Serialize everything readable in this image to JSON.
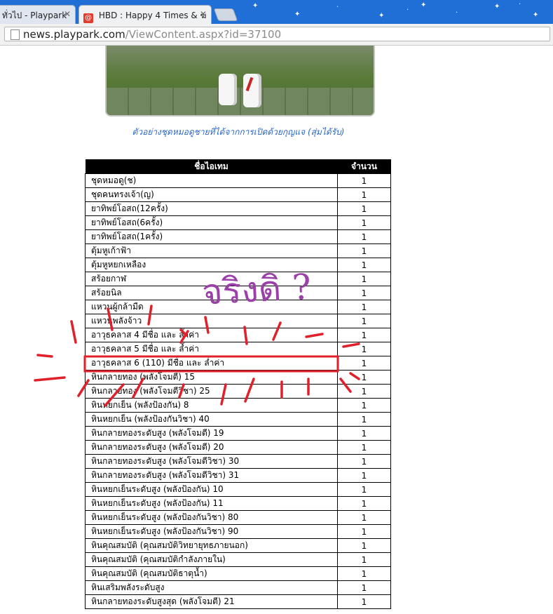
{
  "browser": {
    "tabs": [
      {
        "label": "ทั่วไป - Playpark",
        "active": false
      },
      {
        "label": "HBD : Happy 4 Times & ฆ",
        "active": true
      }
    ],
    "url_host": "news.playpark.com",
    "url_path": "/ViewContent.aspx?id=37100"
  },
  "content": {
    "caption": "ตัวอย่างชุดหมอดูชายที่ได้จากการเปิดด้วยกุญแจ (สุ่มได้รับ)",
    "table": {
      "headers": [
        "ชื่อไอเทม",
        "จำนวน"
      ],
      "rows": [
        [
          "ชุดหมอดู(ช)",
          "1"
        ],
        [
          "ชุดคนทรงเจ้า(ญ)",
          "1"
        ],
        [
          "ยาทิพย์โอสถ(12ครั้ง)",
          "1"
        ],
        [
          "ยาทิพย์โอสถ(6ครั้ง)",
          "1"
        ],
        [
          "ยาทิพย์โอสถ(1ครั้ง)",
          "1"
        ],
        [
          "ตุ้มหูเก้าฟ้า",
          "1"
        ],
        [
          "ตุ้มหูหยกเหลือง",
          "1"
        ],
        [
          "สร้อยกาฬ",
          "1"
        ],
        [
          "สร้อยนิล",
          "1"
        ],
        [
          "แหวนผู้กล้ามืด",
          "1"
        ],
        [
          "แหวนพลังจ้าว",
          "1"
        ],
        [
          "อาวุธคลาส 4 มีชื่อ และ ล้ำค่า",
          "1"
        ],
        [
          "อาวุธคลาส 5 มีชื่อ และ ล้ำค่า",
          "1"
        ],
        [
          "อาวุธคลาส 6 (110) มีชื่อ และ ล่ำค่า",
          "1"
        ],
        [
          "หินกลายทอง (พลังโจมตี) 15",
          "1"
        ],
        [
          "หินกลายทอง (พลังโจมตีวิชา) 25",
          "1"
        ],
        [
          "หินหยกเย็น (พลังป้องกัน) 8",
          "1"
        ],
        [
          "หินหยกเย็น (พลังป้องกันวิชา) 40",
          "1"
        ],
        [
          "หินกลายทองระดับสูง (พลังโจมตี) 19",
          "1"
        ],
        [
          "หินกลายทองระดับสูง (พลังโจมตี) 20",
          "1"
        ],
        [
          "หินกลายทองระดับสูง (พลังโจมตีวิชา) 30",
          "1"
        ],
        [
          "หินกลายทองระดับสูง (พลังโจมตีวิชา) 31",
          "1"
        ],
        [
          "หินหยกเย็นระดับสูง (พลังป้องกัน) 10",
          "1"
        ],
        [
          "หินหยกเย็นระดับสูง (พลังป้องกัน) 11",
          "1"
        ],
        [
          "หินหยกเย็นระดับสูง (พลังป้องกันวิชา) 80",
          "1"
        ],
        [
          "หินหยกเย็นระดับสูง (พลังป้องกันวิชา) 90",
          "1"
        ],
        [
          "หินคุณสมบัติ (คุณสมบัติวิทยายุทธภายนอก)",
          "1"
        ],
        [
          "หินคุณสมบัติ (คุณสมบัติกำลังภายใน)",
          "1"
        ],
        [
          "หินคุณสมบัติ (คุณสมบัติธาตุน้ำ)",
          "1"
        ],
        [
          "หินเสริมพลังระดับสูง",
          "1"
        ],
        [
          "หินกลายทองระดับสูงสุด (พลังโจมตี) 21",
          "1"
        ]
      ]
    }
  },
  "annotation": {
    "scribble_text": "จริงดิ ?",
    "highlight_color": "#e0202a",
    "scribble_color": "#9a40a8"
  }
}
